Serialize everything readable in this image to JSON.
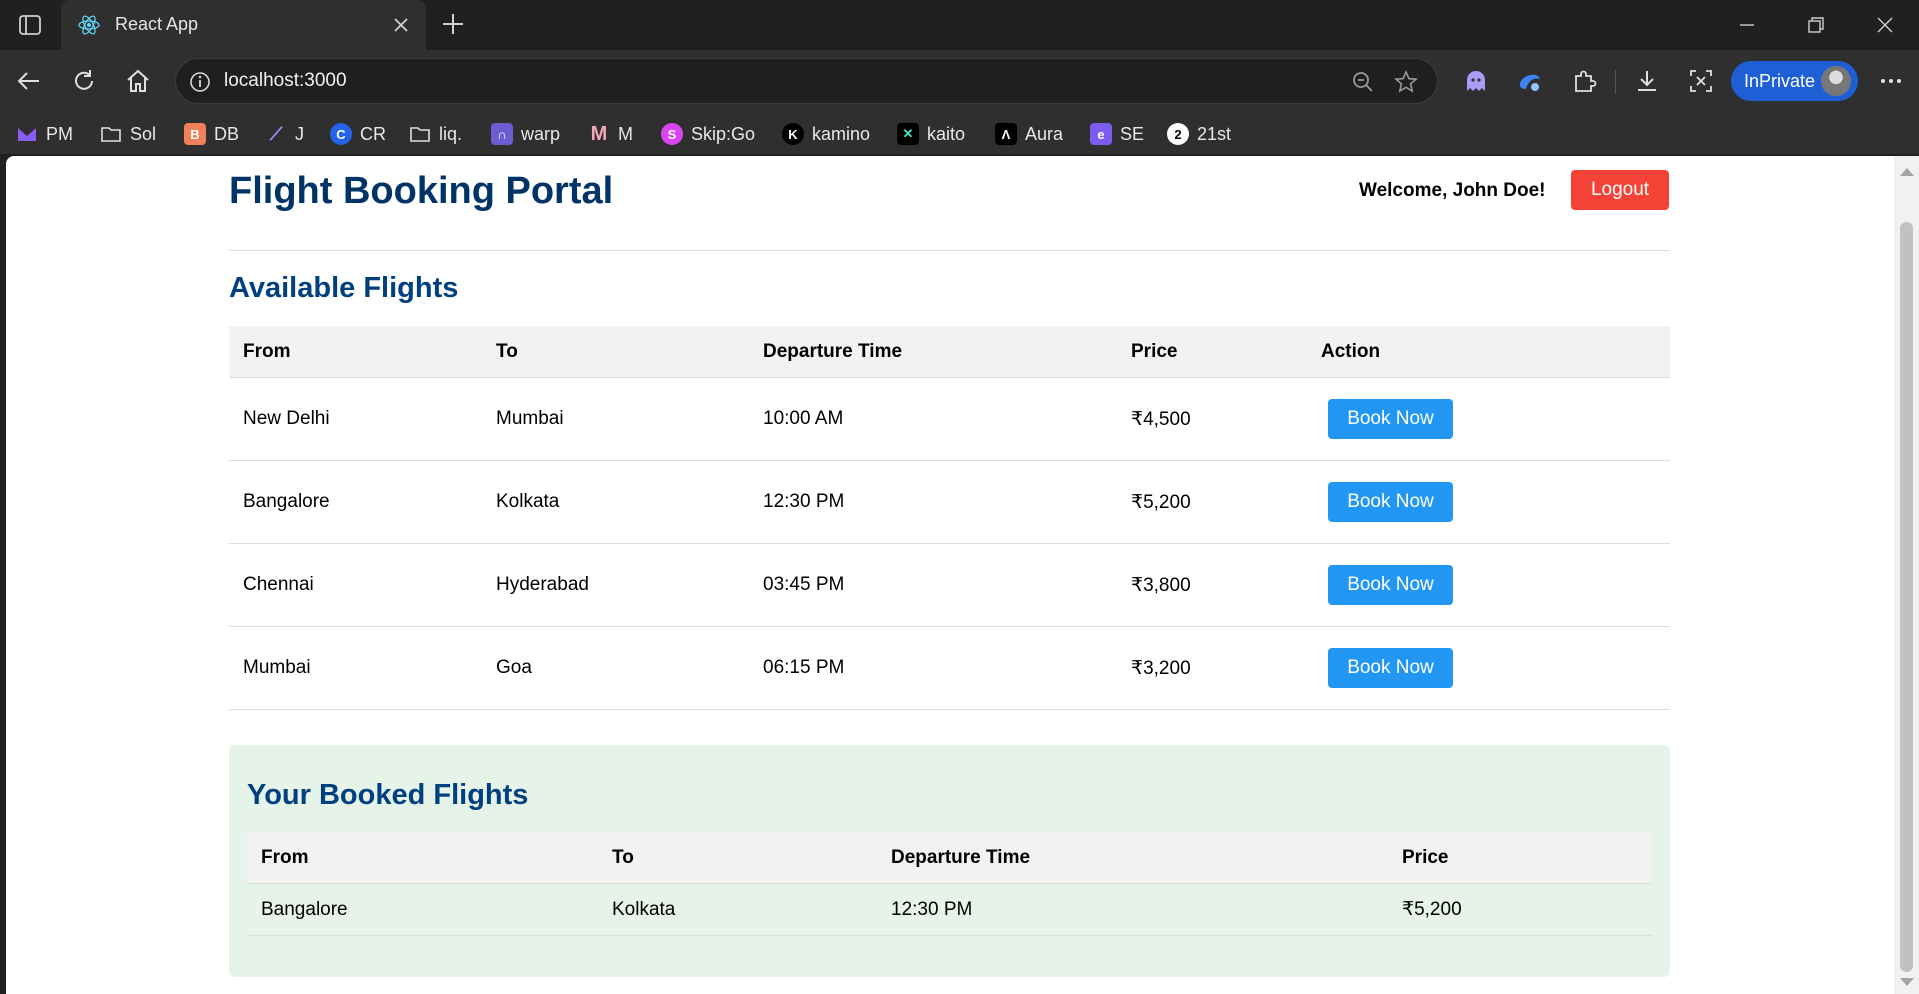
{
  "browser": {
    "tab": {
      "title": "React App",
      "favicon": "react-icon"
    },
    "address": {
      "url": "localhost:3000"
    },
    "inprivate_label": "InPrivate",
    "bookmarks": [
      {
        "label": "PM",
        "icon": "proton-mail-icon"
      },
      {
        "label": "Sol",
        "icon": "folder-icon"
      },
      {
        "label": "DB",
        "icon": "db-icon"
      },
      {
        "label": "J",
        "icon": "j-icon"
      },
      {
        "label": "CR",
        "icon": "cr-icon"
      },
      {
        "label": "liq.",
        "icon": "folder-icon"
      },
      {
        "label": "warp",
        "icon": "warp-icon"
      },
      {
        "label": "M",
        "icon": "m-icon"
      },
      {
        "label": "Skip:Go",
        "icon": "skip-icon"
      },
      {
        "label": "kamino",
        "icon": "kamino-icon"
      },
      {
        "label": "kaito",
        "icon": "kaito-icon"
      },
      {
        "label": "Aura",
        "icon": "aura-icon"
      },
      {
        "label": "SE",
        "icon": "se-icon"
      },
      {
        "label": "21st",
        "icon": "21st-icon"
      }
    ]
  },
  "app": {
    "title": "Flight Booking Portal",
    "welcome": "Welcome, John Doe!",
    "logout_label": "Logout",
    "colors": {
      "title": "#003366",
      "section": "#004080",
      "logout": "#f44336",
      "book": "#2196f3",
      "booked_bg": "#e6f3e8"
    }
  },
  "available": {
    "heading": "Available Flights",
    "columns": [
      "From",
      "To",
      "Departure Time",
      "Price",
      "Action"
    ],
    "rows": [
      {
        "from": "New Delhi",
        "to": "Mumbai",
        "time": "10:00 AM",
        "price": "₹4,500",
        "action": "Book Now"
      },
      {
        "from": "Bangalore",
        "to": "Kolkata",
        "time": "12:30 PM",
        "price": "₹5,200",
        "action": "Book Now"
      },
      {
        "from": "Chennai",
        "to": "Hyderabad",
        "time": "03:45 PM",
        "price": "₹3,800",
        "action": "Book Now"
      },
      {
        "from": "Mumbai",
        "to": "Goa",
        "time": "06:15 PM",
        "price": "₹3,200",
        "action": "Book Now"
      }
    ]
  },
  "booked": {
    "heading": "Your Booked Flights",
    "columns": [
      "From",
      "To",
      "Departure Time",
      "Price"
    ],
    "rows": [
      {
        "from": "Bangalore",
        "to": "Kolkata",
        "time": "12:30 PM",
        "price": "₹5,200"
      }
    ]
  }
}
